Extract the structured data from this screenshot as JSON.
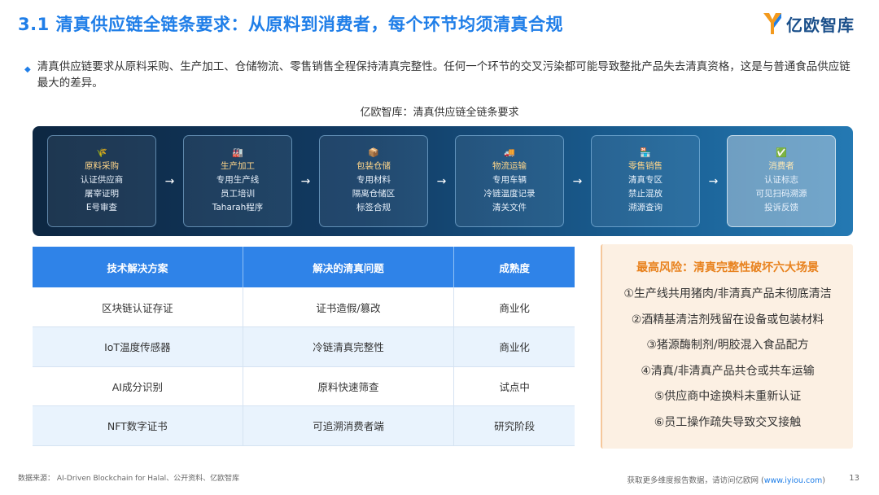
{
  "header": {
    "title": "3.1 清真供应链全链条要求：从原料到消费者，每个环节均须清真合规",
    "logo_text": "亿欧智库"
  },
  "intro": {
    "text": "清真供应链要求从原料采购、生产加工、仓储物流、零售销售全程保持清真完整性。任何一个环节的交叉污染都可能导致整批产品失去清真资格，这是与普通食品供应链最大的差异。"
  },
  "flow": {
    "title": "亿欧智库：清真供应链全链条要求",
    "stages": [
      {
        "icon": "🌾",
        "name": "原料采购",
        "lines": [
          "认证供应商",
          "屠宰证明",
          "E号审查"
        ]
      },
      {
        "icon": "🏭",
        "name": "生产加工",
        "lines": [
          "专用生产线",
          "员工培训",
          "Taharah程序"
        ]
      },
      {
        "icon": "📦",
        "name": "包装仓储",
        "lines": [
          "专用材料",
          "隔离仓储区",
          "标签合规"
        ]
      },
      {
        "icon": "🚚",
        "name": "物流运输",
        "lines": [
          "专用车辆",
          "冷链温度记录",
          "清关文件"
        ]
      },
      {
        "icon": "🏪",
        "name": "零售销售",
        "lines": [
          "清真专区",
          "禁止混放",
          "溯源查询"
        ]
      },
      {
        "icon": "✅",
        "name": "消费者",
        "lines": [
          "认证标志",
          "可见扫码溯源",
          "投诉反馈"
        ]
      }
    ]
  },
  "table": {
    "headers": [
      "技术解决方案",
      "解决的清真问题",
      "成熟度"
    ],
    "rows": [
      [
        "区块链认证存证",
        "证书造假/篡改",
        "商业化"
      ],
      [
        "IoT温度传感器",
        "冷链清真完整性",
        "商业化"
      ],
      [
        "AI成分识别",
        "原料快速筛查",
        "试点中"
      ],
      [
        "NFT数字证书",
        "可追溯消费者端",
        "研究阶段"
      ]
    ]
  },
  "risk": {
    "title": "最高风险：清真完整性破坏六大场景",
    "items": [
      "①生产线共用猪肉/非清真产品未彻底清洁",
      "②酒精基清洁剂残留在设备或包装材料",
      "③猪源酶制剂/明胶混入食品配方",
      "④清真/非清真产品共仓或共车运输",
      "⑤供应商中途换料未重新认证",
      "⑥员工操作疏失导致交叉接触"
    ]
  },
  "footer": {
    "source": "数据来源： AI-Driven Blockchain for Halal、公开资料、亿欧智库",
    "more_text": "获取更多维度报告数据，请访问亿欧网 (",
    "link": "www.iyiou.com",
    "more_close": ")",
    "page": "13"
  },
  "colors": {
    "accent": "#1f7ee8",
    "table_header": "#2f83e8",
    "risk_title": "#e8821e",
    "risk_bg": "#fcf0e3"
  }
}
